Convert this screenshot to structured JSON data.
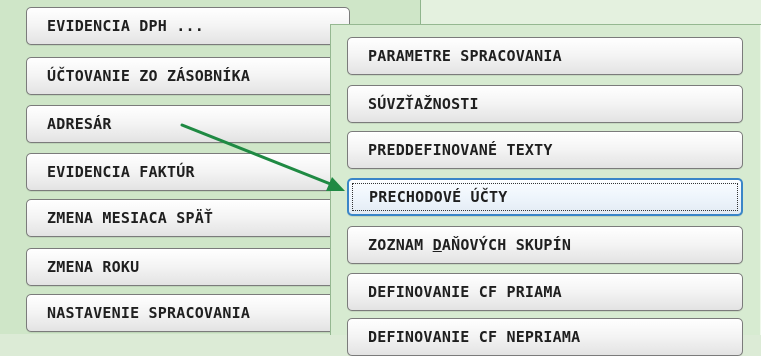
{
  "left_menu": {
    "items": [
      {
        "label": "EVIDENCIA DPH ..."
      },
      {
        "label": "ÚČTOVANIE ZO ZÁSOBNÍKA"
      },
      {
        "label": "ADRESÁR"
      },
      {
        "label": "EVIDENCIA FAKTÚR"
      },
      {
        "label": "ZMENA MESIACA SPÄŤ"
      },
      {
        "label": "ZMENA ROKU"
      },
      {
        "label": "NASTAVENIE SPRACOVANIA"
      }
    ]
  },
  "right_menu": {
    "items": [
      {
        "label": "PARAMETRE SPRACOVANIA"
      },
      {
        "label": "SÚVZŤAŽNOSTI"
      },
      {
        "label": "PREDDEFINOVANÉ TEXTY"
      },
      {
        "label": "PRECHODOVÉ ÚČTY",
        "focused": true
      },
      {
        "label_prefix": "ZOZNAM ",
        "label_underlined": "D",
        "label_suffix": "AŇOVÝCH SKUPÍN"
      },
      {
        "label": "DEFINOVANIE CF PRIAMA"
      },
      {
        "label": "DEFINOVANIE CF NEPRIAMA"
      }
    ]
  },
  "annotation": {
    "arrow_color": "#1f8a43"
  }
}
